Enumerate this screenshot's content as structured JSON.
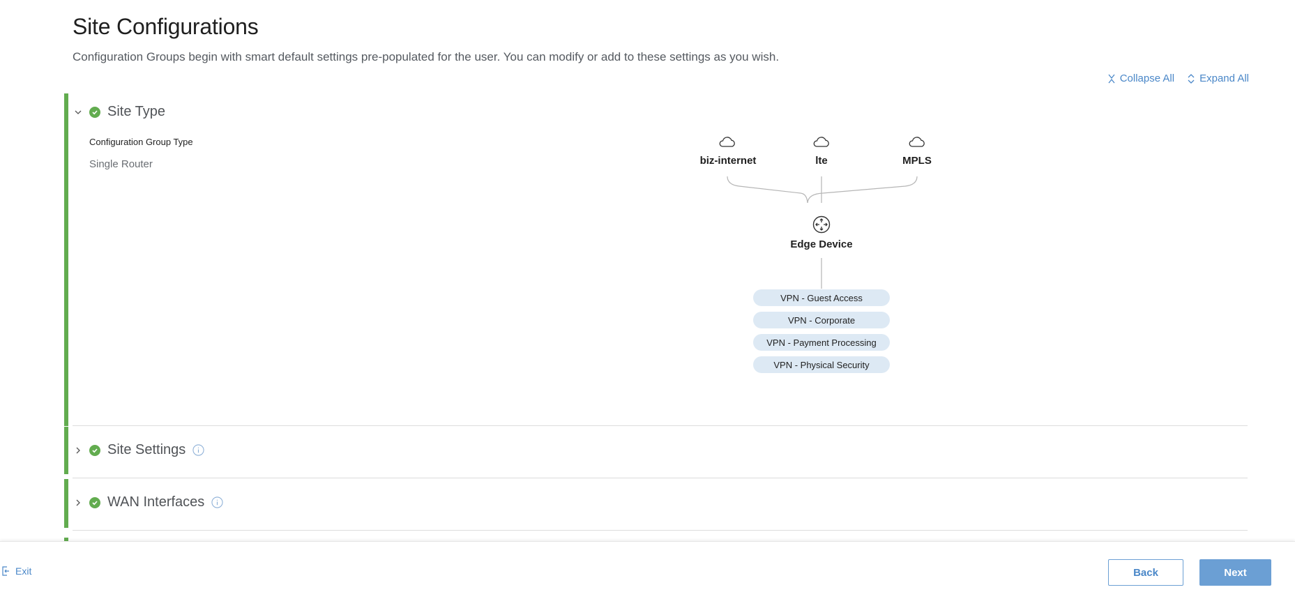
{
  "page": {
    "title": "Site Configurations",
    "subtitle": "Configuration Groups begin with smart default settings pre-populated for the user. You can modify or add to these settings as you wish."
  },
  "toolbar": {
    "collapse_all": "Collapse All",
    "expand_all": "Expand All"
  },
  "sections": {
    "site_type": {
      "title": "Site Type",
      "expanded": true,
      "status": "complete",
      "field_label": "Configuration Group Type",
      "field_value": "Single Router"
    },
    "site_settings": {
      "title": "Site Settings",
      "expanded": false,
      "status": "complete"
    },
    "wan_interfaces": {
      "title": "WAN Interfaces",
      "expanded": false,
      "status": "complete"
    }
  },
  "diagram": {
    "networks": [
      "biz-internet",
      "lte",
      "MPLS"
    ],
    "device": "Edge Device",
    "vpns": [
      "VPN - Guest Access",
      "VPN - Corporate",
      "VPN - Payment Processing",
      "VPN - Physical Security"
    ]
  },
  "footer": {
    "exit": "Exit",
    "back": "Back",
    "next": "Next"
  },
  "colors": {
    "accent": "#62ac4f",
    "link": "#4a87c8",
    "primary_button": "#6b9fd4",
    "pill": "#dde9f4"
  },
  "icons": {
    "collapse": "collapse-all-icon",
    "expand": "expand-all-icon",
    "status": "check-circle-icon",
    "network": "cloud-icon",
    "device": "router-icon",
    "info": "info-icon",
    "exit": "exit-icon"
  }
}
